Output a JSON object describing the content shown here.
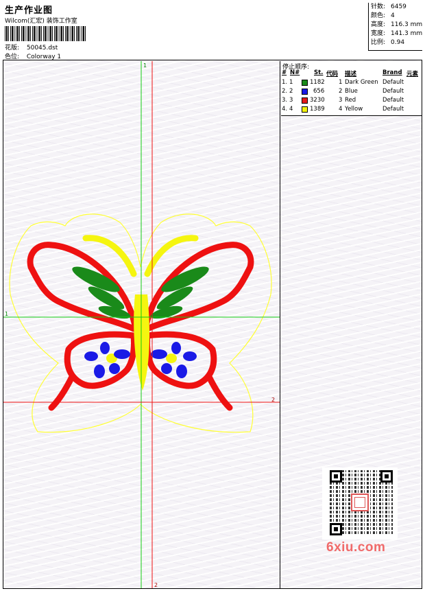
{
  "header": {
    "title": "生产作业图",
    "company": "Wilcom(汇宏) 装饰工作室",
    "design_label": "花版:",
    "design_value": "50045.dst",
    "colorway_label": "色位:",
    "colorway_value": "Colorway 1"
  },
  "stats": [
    {
      "label": "针数:",
      "value": "6459"
    },
    {
      "label": "颜色:",
      "value": "4"
    },
    {
      "label": "高度:",
      "value": "116.3 mm"
    },
    {
      "label": "宽度:",
      "value": "141.3 mm"
    },
    {
      "label": "比例:",
      "value": "0.94"
    }
  ],
  "stop_sequence": {
    "title": "停止顺序:",
    "columns": [
      "#",
      "N#",
      "St.",
      "代码",
      "描述",
      "Brand",
      "元素"
    ],
    "rows": [
      {
        "num": "1.",
        "n": "1",
        "color": "#1a8a1a",
        "stitches": "1182",
        "code": "1",
        "desc": "Dark Green",
        "brand": "Default"
      },
      {
        "num": "2.",
        "n": "2",
        "color": "#1a1ae6",
        "stitches": "656",
        "code": "2",
        "desc": "Blue",
        "brand": "Default"
      },
      {
        "num": "3.",
        "n": "3",
        "color": "#e61a1a",
        "stitches": "3230",
        "code": "3",
        "desc": "Red",
        "brand": "Default"
      },
      {
        "num": "4.",
        "n": "4",
        "color": "#f2f20d",
        "stitches": "1389",
        "code": "4",
        "desc": "Yellow",
        "brand": "Default"
      }
    ]
  },
  "axes": {
    "green_top": "1",
    "green_left": "1",
    "red_right": "2",
    "red_bottom": "2"
  },
  "watermark": "6xiu.com"
}
